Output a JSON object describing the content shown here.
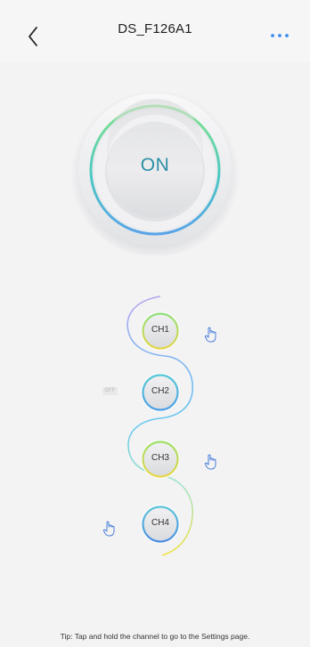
{
  "header": {
    "title": "DS_F126A1",
    "back_icon": "chevron-left-icon",
    "more_icon": "more-dots-icon",
    "accent": "#3a8df0"
  },
  "power": {
    "label": "ON",
    "label_color": "#2b8fa7",
    "ring_colors": [
      "#7ee08a",
      "#46c5c9",
      "#5aa7e5"
    ]
  },
  "channels": [
    {
      "label": "CH1",
      "hand_icon": true
    },
    {
      "label": "CH2",
      "status_tag": "OFF",
      "hand_icon": false
    },
    {
      "label": "CH3",
      "hand_icon": true
    },
    {
      "label": "CH4",
      "hand_icon": true
    }
  ],
  "tip": "Tip: Tap and hold the channel to go to the Settings page."
}
